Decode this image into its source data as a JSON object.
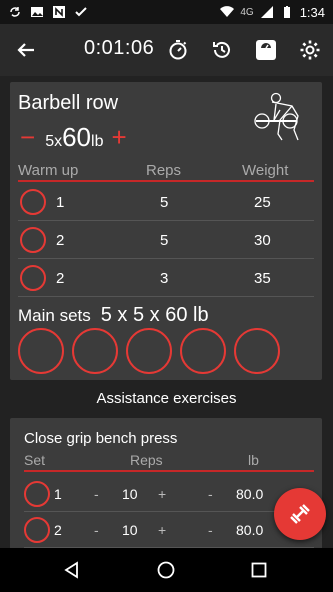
{
  "status_bar": {
    "time": "1:34",
    "network": "4G"
  },
  "toolbar": {
    "timer": "0:01:06"
  },
  "exercise": {
    "name": "Barbell row",
    "sets_reps": "5x",
    "weight": "60",
    "unit": "lb",
    "minus": "−",
    "plus": "+",
    "warmup_headers": [
      "Warm up",
      "Reps",
      "Weight"
    ],
    "warmup_rows": [
      {
        "set": "1",
        "reps": "5",
        "weight": "25"
      },
      {
        "set": "2",
        "reps": "5",
        "weight": "30"
      },
      {
        "set": "2",
        "reps": "3",
        "weight": "35"
      }
    ],
    "main_sets_label": "Main sets",
    "main_sets_value": "5 x 5 x 60 lb"
  },
  "assistance": {
    "header": "Assistance exercises",
    "name": "Close grip bench press",
    "headers": [
      "Set",
      "Reps",
      "lb"
    ],
    "rows": [
      {
        "set": "1",
        "minus": "-",
        "reps": "10",
        "plus": "+",
        "lb_minus": "-",
        "lb": "80.0"
      },
      {
        "set": "2",
        "minus": "-",
        "reps": "10",
        "plus": "+",
        "lb_minus": "-",
        "lb": "80.0"
      }
    ]
  },
  "colors": {
    "accent": "#e53935",
    "card": "#3c3c3c",
    "background": "#222222"
  }
}
